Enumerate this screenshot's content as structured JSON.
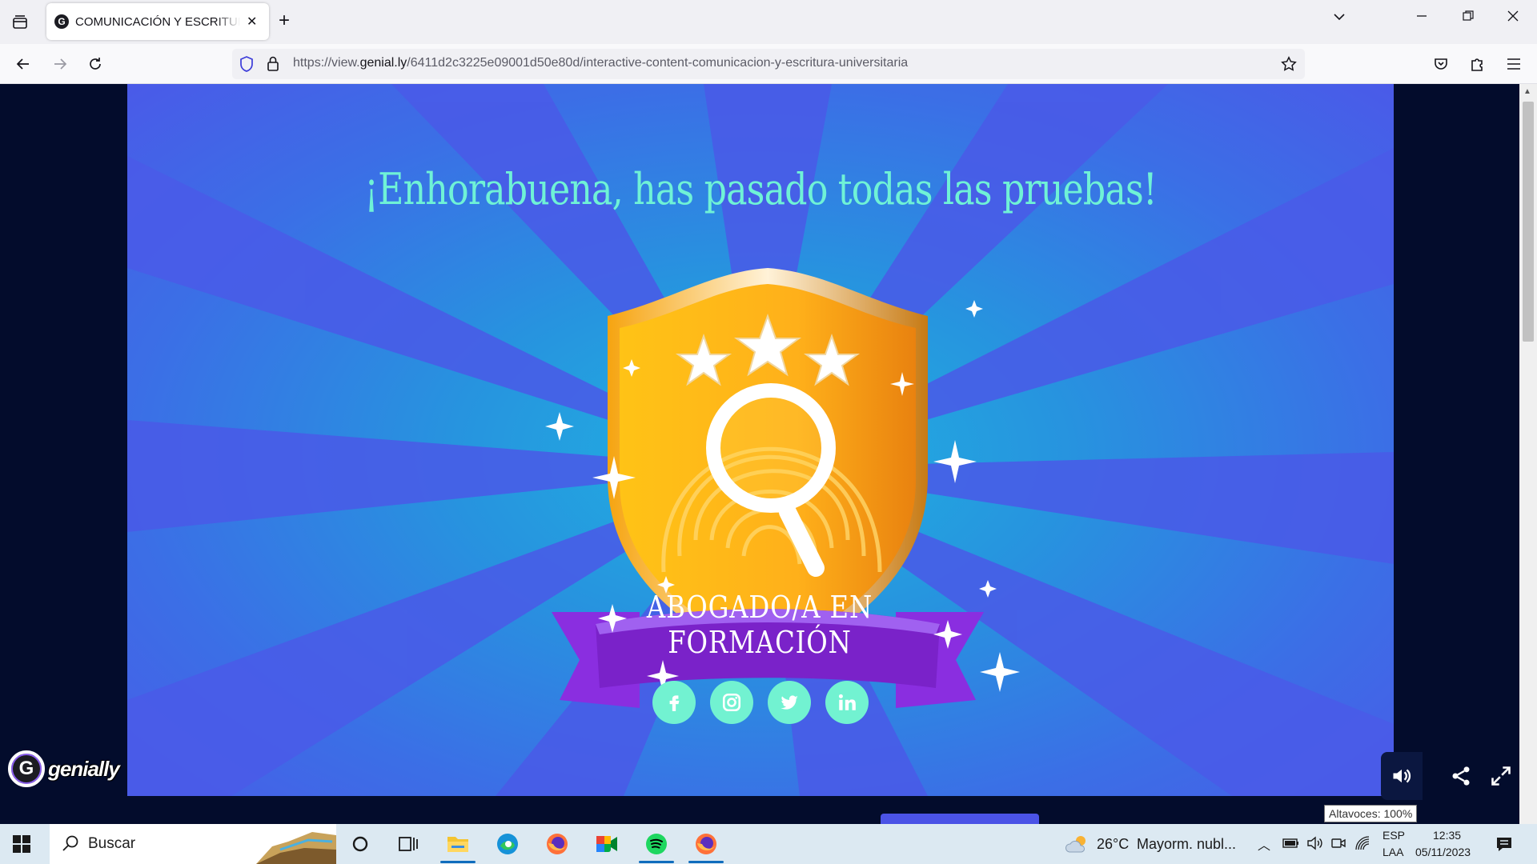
{
  "browser": {
    "tab": {
      "title": "COMUNICACIÓN Y ESCRITURA UNIVERSITARIA"
    },
    "url": {
      "prefix": "https://view.",
      "domain": "genial.ly",
      "path": "/6411d2c3225e09001d50e80d/interactive-content-comunicacion-y-escritura-universitaria"
    }
  },
  "page": {
    "headline": "¡Enhorabuena, has pasado todas las pruebas!",
    "badge_label": "ABOGADO/A EN FORMACIÓN",
    "social": [
      "facebook-icon",
      "instagram-icon",
      "twitter-icon",
      "linkedin-icon"
    ],
    "brand": "genially"
  },
  "tooltip": {
    "text": "Altavoces: 100%"
  },
  "taskbar": {
    "search_label": "Buscar",
    "weather": {
      "temp": "26°C",
      "condition": "Mayorm. nubl..."
    },
    "lang": {
      "code": "ESP",
      "layout": "LAA"
    },
    "clock": {
      "time": "12:35",
      "date": "05/11/2023"
    },
    "apps": [
      "task-view-icon",
      "file-explorer-icon",
      "edge-icon",
      "firefox-icon",
      "meet-icon",
      "spotify-icon",
      "firefox-active-icon"
    ]
  },
  "colors": {
    "headline": "#6ff2d6",
    "social_bg": "#72f2d1",
    "ribbon": "#7a22c9",
    "shield": "#ffb21a",
    "stage_edge": "#4a5ae8"
  }
}
